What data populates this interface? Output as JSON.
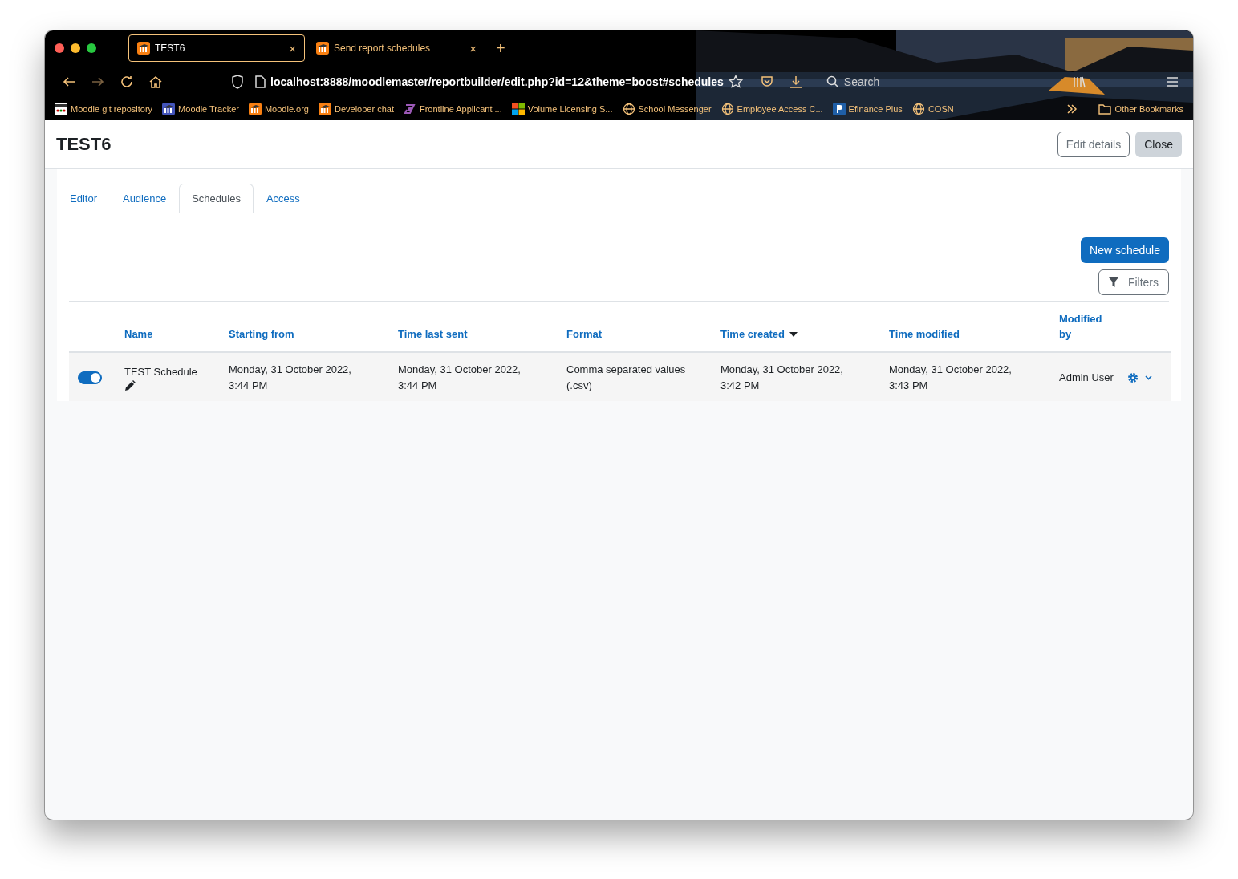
{
  "browser": {
    "tabs": [
      {
        "title": "TEST6",
        "selected": true
      },
      {
        "title": "Send report schedules",
        "selected": false
      }
    ],
    "new_tab": "+",
    "close": "×",
    "url": "localhost:8888/moodlemaster/reportbuilder/edit.php?id=12&theme=boost#schedules",
    "search_placeholder": "Search",
    "bookmarks": [
      {
        "label": "Moodle git repository",
        "kind": "grid"
      },
      {
        "label": "Moodle Tracker",
        "kind": "tracker"
      },
      {
        "label": "Moodle.org",
        "kind": "moodle"
      },
      {
        "label": "Developer chat",
        "kind": "moodle"
      },
      {
        "label": "Frontline Applicant ...",
        "kind": "frontline"
      },
      {
        "label": "Volume Licensing S...",
        "kind": "windows"
      },
      {
        "label": "School Messenger",
        "kind": "globe"
      },
      {
        "label": "Employee Access C...",
        "kind": "globe"
      },
      {
        "label": "Efinance Plus",
        "kind": "p"
      },
      {
        "label": "COSN",
        "kind": "globe"
      }
    ],
    "other_bookmarks": "Other Bookmarks"
  },
  "page": {
    "title": "TEST6",
    "buttons": [
      {
        "label": "Edit details",
        "kind": "outline"
      },
      {
        "label": "Close",
        "kind": "secondary"
      }
    ],
    "tabs": [
      {
        "label": "Editor",
        "selected": false
      },
      {
        "label": "Audience",
        "selected": false
      },
      {
        "label": "Schedules",
        "selected": true
      },
      {
        "label": "Access",
        "selected": false
      }
    ],
    "new_schedule": "New schedule",
    "filters": "Filters",
    "table": {
      "columns": [
        {
          "label": "Name",
          "sorted": false
        },
        {
          "label": "Starting from",
          "sorted": false
        },
        {
          "label": "Time last sent",
          "sorted": false
        },
        {
          "label": "Format",
          "sorted": false
        },
        {
          "label": "Time created",
          "sorted": true
        },
        {
          "label": "Time modified",
          "sorted": false
        },
        {
          "label": "Modified by",
          "sorted": false
        }
      ],
      "rows": [
        {
          "enabled": true,
          "cells": [
            "TEST Schedule",
            "Monday, 31 October 2022, 3:44 PM",
            "Monday, 31 October 2022, 3:44 PM",
            "Comma separated values (.csv)",
            "Monday, 31 October 2022, 3:42 PM",
            "Monday, 31 October 2022, 3:43 PM",
            "Admin User"
          ]
        }
      ]
    }
  }
}
